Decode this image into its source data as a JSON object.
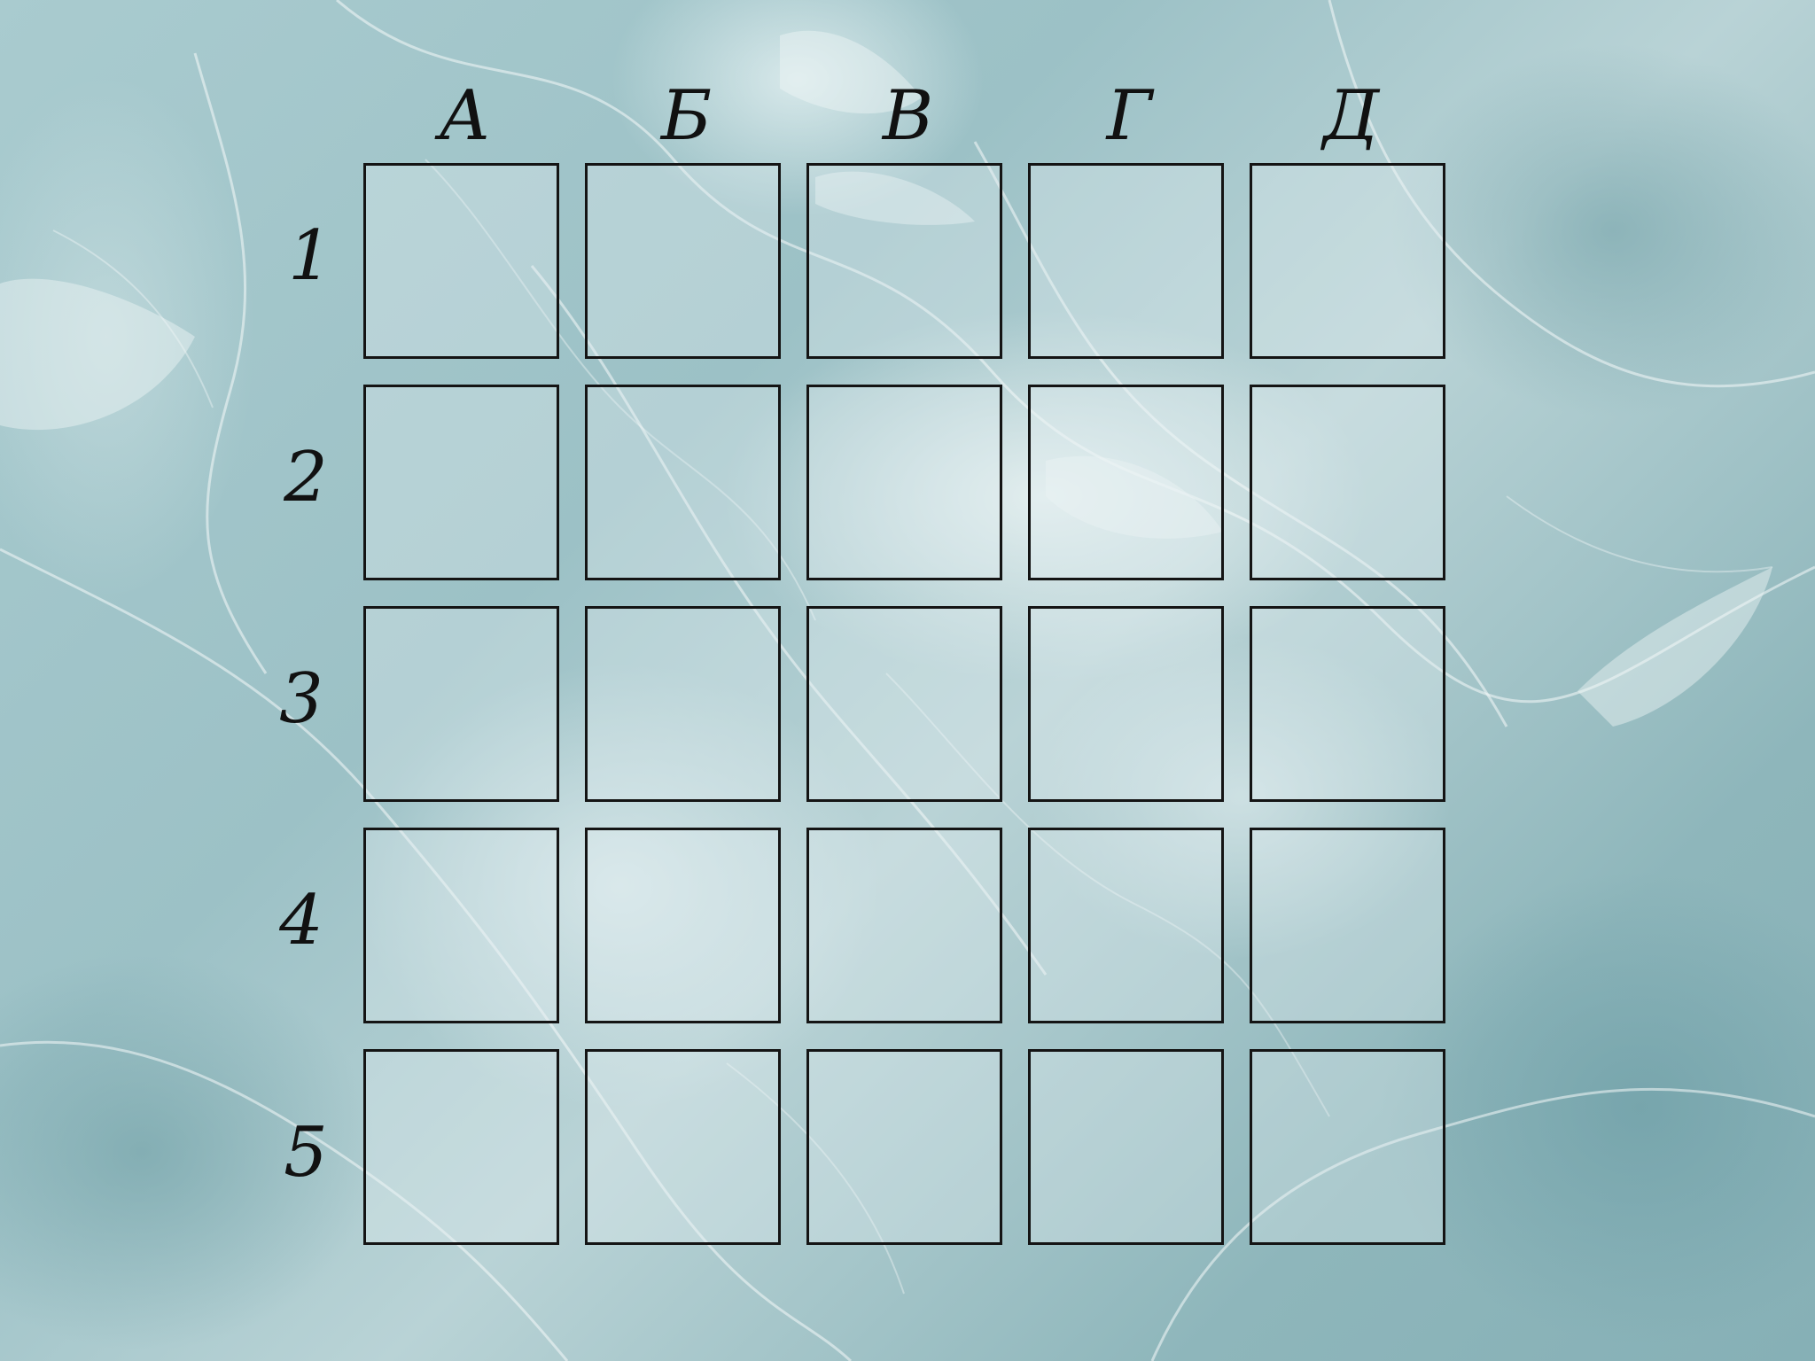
{
  "board": {
    "columns": [
      "А",
      "Б",
      "В",
      "Г",
      "Д"
    ],
    "rows": [
      "1",
      "2",
      "3",
      "4",
      "5"
    ]
  },
  "colors": {
    "cell_border": "#141414",
    "label_color": "#111111",
    "background_base": "#9cc1c6"
  }
}
